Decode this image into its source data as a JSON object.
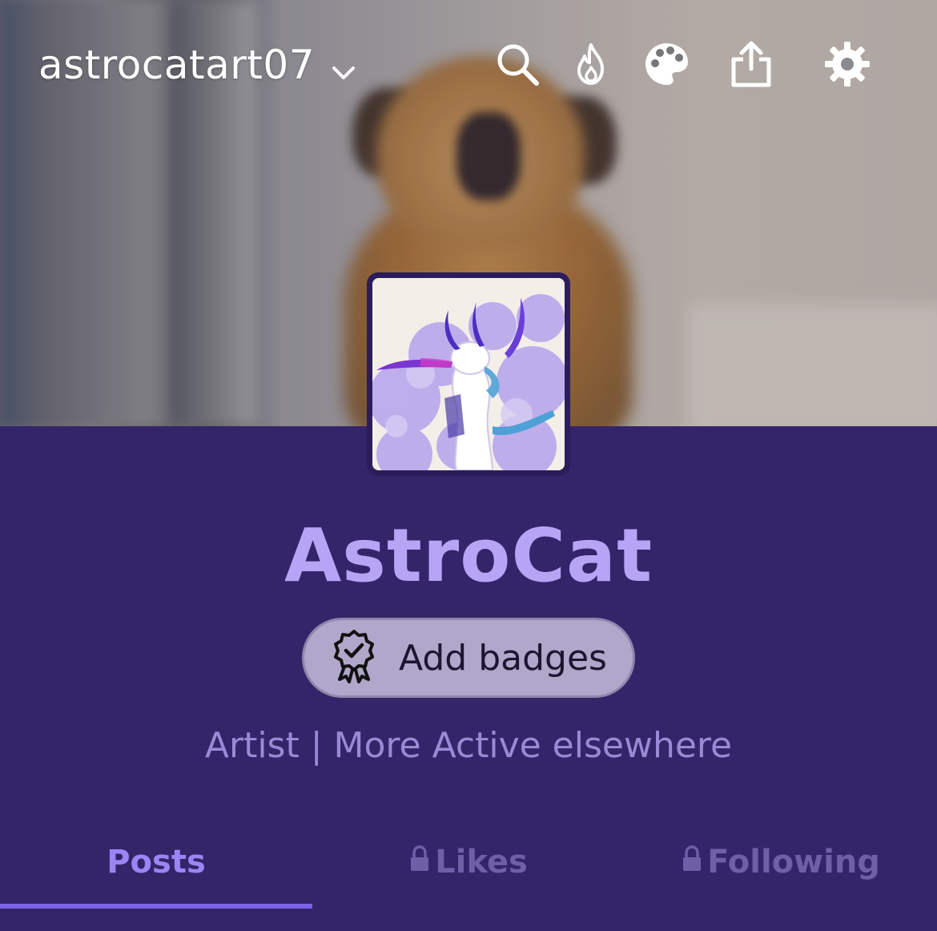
{
  "header": {
    "username": "astrocatart07",
    "icons": [
      "chevron-down-icon",
      "search-icon",
      "flame-icon",
      "palette-icon",
      "share-icon",
      "gear-icon"
    ]
  },
  "profile": {
    "display_name": "AstroCat",
    "badge_button_label": "Add badges",
    "bio": "Artist | More Active elsewhere"
  },
  "tabs": [
    {
      "label": "Posts",
      "locked": false,
      "active": true
    },
    {
      "label": "Likes",
      "locked": true,
      "active": false
    },
    {
      "label": "Following",
      "locked": true,
      "active": false
    }
  ],
  "colors": {
    "background": "#34256a",
    "accent": "#b7a4f5",
    "active_tab": "#9b85f5",
    "inactive_tab": "#6d5fa8",
    "badge_button": "#b0a7cb"
  }
}
